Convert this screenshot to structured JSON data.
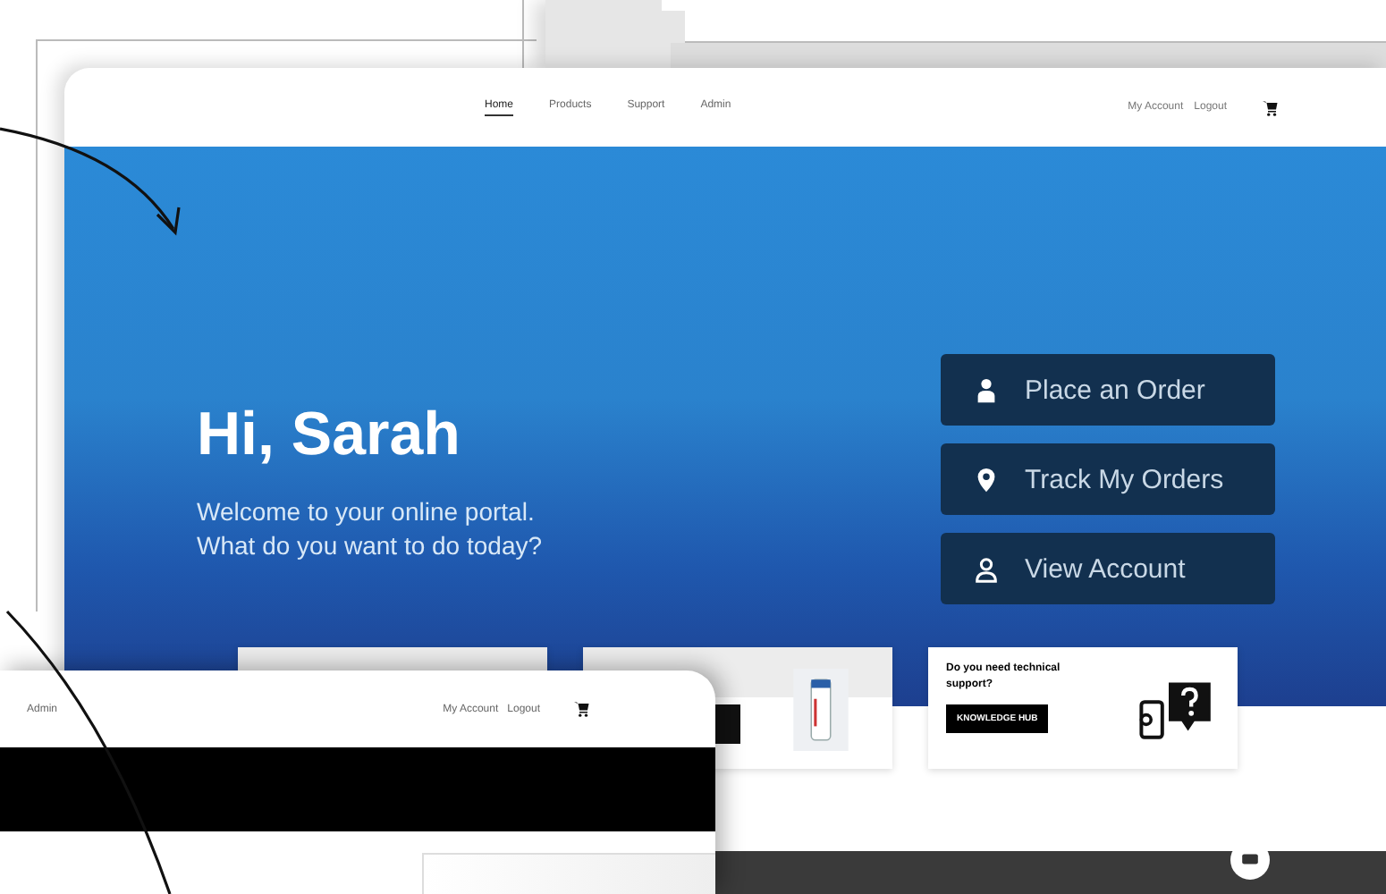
{
  "main_screen": {
    "nav": {
      "links": [
        {
          "label": "Home",
          "selected": true
        },
        {
          "label": "Products",
          "selected": false
        },
        {
          "label": "Support",
          "selected": false
        },
        {
          "label": "Admin",
          "selected": false
        }
      ],
      "account_links": [
        "My Account",
        "Logout"
      ]
    },
    "hero": {
      "greeting": "Hi, Sarah",
      "subtitle_lines": [
        "Welcome to your online portal.",
        "What do you want to do today?"
      ],
      "actions": [
        {
          "label": "Place an Order",
          "kind": "order"
        },
        {
          "label": "Track My Orders",
          "kind": "track"
        },
        {
          "label": "View Account",
          "kind": "account"
        }
      ]
    },
    "support_card": {
      "title": "Do you need technical support?",
      "button": "KNOWLEDGE HUB"
    }
  },
  "front_screen": {
    "nav": {
      "links": [
        "Admin"
      ],
      "account_links": [
        "My Account",
        "Logout"
      ]
    }
  }
}
